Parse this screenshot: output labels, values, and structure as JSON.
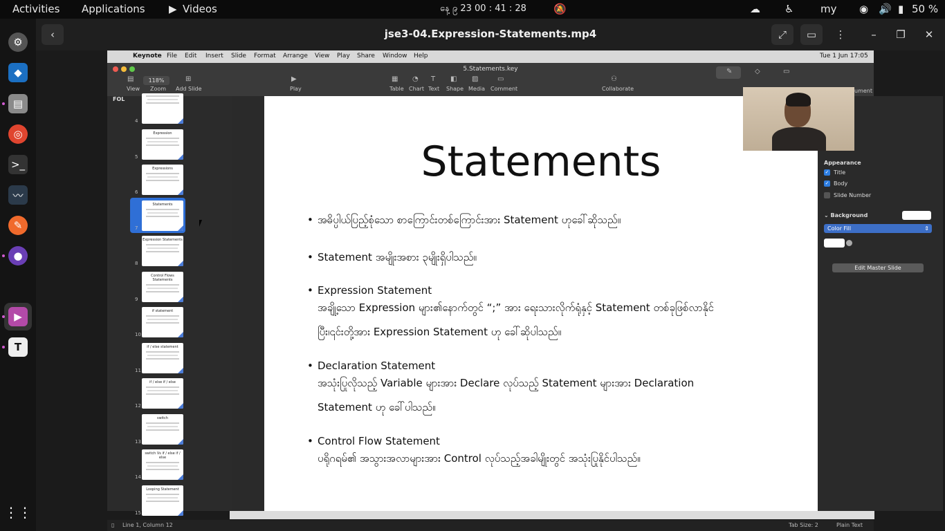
{
  "topbar": {
    "activities": "Activities",
    "applications": "Applications",
    "videos": "Videos",
    "clock": "နေ့ ၉  23  00   : 41   : 28",
    "keyboard": "my",
    "battery": "50 %"
  },
  "window": {
    "title": "jse3-04.Expression-Statements.mp4"
  },
  "mac_menubar": {
    "items": [
      "Keynote",
      "File",
      "Edit",
      "Insert",
      "Slide",
      "Format",
      "Arrange",
      "View",
      "Play",
      "Share",
      "Window",
      "Help"
    ],
    "doc_title": "5.Statements.key",
    "datetime": "Tue 1 Jun  17:05"
  },
  "toolbar": {
    "zoom_value": "118%",
    "labels": [
      "View",
      "Zoom",
      "Add Slide",
      "Play",
      "Table",
      "Chart",
      "Text",
      "Shape",
      "Media",
      "Comment",
      "Collaborate",
      "ument"
    ]
  },
  "navigator": {
    "header": "FOL",
    "slides": [
      {
        "num": "4",
        "title": ""
      },
      {
        "num": "5",
        "title": "Expression"
      },
      {
        "num": "6",
        "title": "Expressions"
      },
      {
        "num": "7",
        "title": "Statements",
        "selected": true
      },
      {
        "num": "8",
        "title": "Expression Statements"
      },
      {
        "num": "9",
        "title": "Control Flows Statements"
      },
      {
        "num": "10",
        "title": "if statement"
      },
      {
        "num": "11",
        "title": "if / else statement"
      },
      {
        "num": "12",
        "title": "if / else if / else"
      },
      {
        "num": "13",
        "title": "switch"
      },
      {
        "num": "14",
        "title": "switch Vs if / else if / else"
      },
      {
        "num": "15",
        "title": "Looping Statement"
      }
    ]
  },
  "slide": {
    "title": "Statements",
    "bullets": [
      {
        "line1": "အဓိပ္ပါယ်ပြည့်စုံသော စာကြောင်းတစ်ကြောင်းအား Statement ဟုခေါ်ဆိုသည်။"
      },
      {
        "line1": "Statement အမျိုးအစား ၃မျိုးရှိပါသည်။"
      },
      {
        "line1": "Expression Statement",
        "line2": "အချို့သော Expression များ၏နောက်တွင် “;” အား ရေးသားလိုက်ရုံနှင့် Statement တစ်ခုဖြစ်လာနိုင်",
        "line3": "ပြီး၊၎င်းတို့အား Expression Statement ဟု ခေါ်ဆိုပါသည်။"
      },
      {
        "line1": "Declaration Statement",
        "line2": "အသုံးပြုလိုသည့် Variable များအား Declare လုပ်သည့် Statement များအား Declaration",
        "line3": "Statement ဟု ခေါ်ပါသည်။"
      },
      {
        "line1": "Control Flow Statement",
        "line2": "ပရိုဂရမ်၏ အသွားအလာများအား Control လုပ်သည့်အခါမျိုးတွင် အသုံးပြုနိုင်ပါသည်။"
      }
    ]
  },
  "inspector": {
    "appearance": "Appearance",
    "title_cb": "Title",
    "body_cb": "Body",
    "slide_number_cb": "Slide Number",
    "background": "Background",
    "fill_type": "Color Fill",
    "edit_master": "Edit Master Slide"
  },
  "statusbar": {
    "position": "Line 1, Column 12",
    "tab_size": "Tab Size: 2",
    "mode": "Plain Text"
  }
}
